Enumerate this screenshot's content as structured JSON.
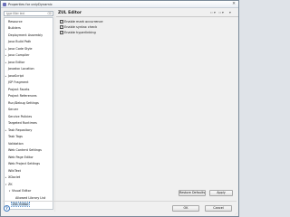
{
  "window": {
    "title": "Properties for onlyDynamic",
    "close_glyph": "✕"
  },
  "filter": {
    "placeholder": "type filter text",
    "clear_glyph": "⌫"
  },
  "tree": {
    "items": [
      {
        "label": "Resource",
        "level": 0,
        "twisty": ""
      },
      {
        "label": "Builders",
        "level": 0,
        "twisty": ""
      },
      {
        "label": "Deployment Assembly",
        "level": 0,
        "twisty": ""
      },
      {
        "label": "Java Build Path",
        "level": 0,
        "twisty": ""
      },
      {
        "label": "Java Code Style",
        "level": 0,
        "twisty": "▸"
      },
      {
        "label": "Java Compiler",
        "level": 0,
        "twisty": "▸"
      },
      {
        "label": "Java Editor",
        "level": 0,
        "twisty": "▸"
      },
      {
        "label": "Javadoc Location",
        "level": 0,
        "twisty": ""
      },
      {
        "label": "JavaScript",
        "level": 0,
        "twisty": "▸"
      },
      {
        "label": "JSP Fragment",
        "level": 0,
        "twisty": ""
      },
      {
        "label": "Project Facets",
        "level": 0,
        "twisty": ""
      },
      {
        "label": "Project References",
        "level": 0,
        "twisty": ""
      },
      {
        "label": "Run/Debug Settings",
        "level": 0,
        "twisty": ""
      },
      {
        "label": "Server",
        "level": 0,
        "twisty": ""
      },
      {
        "label": "Service Policies",
        "level": 0,
        "twisty": ""
      },
      {
        "label": "Targeted Runtimes",
        "level": 0,
        "twisty": ""
      },
      {
        "label": "Task Repository",
        "level": 0,
        "twisty": "▸"
      },
      {
        "label": "Task Tags",
        "level": 0,
        "twisty": ""
      },
      {
        "label": "Validation",
        "level": 0,
        "twisty": ""
      },
      {
        "label": "Web Content Settings",
        "level": 0,
        "twisty": ""
      },
      {
        "label": "Web Page Editor",
        "level": 0,
        "twisty": ""
      },
      {
        "label": "Web Project Settings",
        "level": 0,
        "twisty": ""
      },
      {
        "label": "WikiText",
        "level": 0,
        "twisty": ""
      },
      {
        "label": "XDoclet",
        "level": 0,
        "twisty": "▸"
      },
      {
        "label": "ZK",
        "level": 0,
        "twisty": "▾"
      },
      {
        "label": "Visual Editor",
        "level": 1,
        "twisty": "▾"
      },
      {
        "label": "Allowed Library List",
        "level": 2,
        "twisty": ""
      },
      {
        "label": "ZUL Editor",
        "level": 1,
        "twisty": "",
        "selected": true
      }
    ]
  },
  "page": {
    "title": "ZUL Editor",
    "nav_back": "⇦",
    "nav_back_menu": "▾",
    "nav_forward": "⇨",
    "nav_forward_menu": "▾",
    "menu": "▾",
    "checkboxes": [
      {
        "label": "Enable mark occurrence",
        "checked": true
      },
      {
        "label": "Enable syntax check",
        "checked": true
      },
      {
        "label": "Enable hyperlinking",
        "checked": true
      }
    ],
    "restore_defaults_label": "Restore Defaults",
    "apply_label": "Apply"
  },
  "footer": {
    "help_glyph": "?",
    "ok_label": "OK",
    "cancel_label": "Cancel",
    "grip_glyph": "⋰"
  },
  "colors": {
    "selection": "#cde3f7",
    "help_accent": "#3f7bc1"
  }
}
